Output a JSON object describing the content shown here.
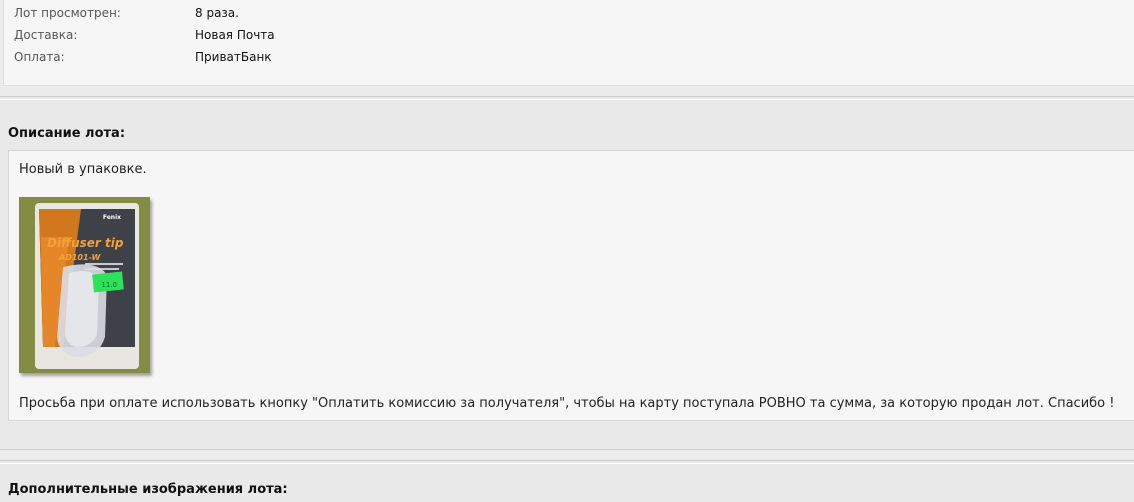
{
  "lot_info": {
    "rows": [
      {
        "label": "Лот просмотрен:",
        "value": "8 раза."
      },
      {
        "label": "Доставка:",
        "value": "Новая Почта"
      },
      {
        "label": "Оплата:",
        "value": "ПриватБанк"
      }
    ]
  },
  "description": {
    "title": "Описание лота:",
    "intro": "Новый в упаковке.",
    "image": {
      "brand": "Fenix",
      "product_name": "Diffuser tip",
      "model": "AD101-W",
      "price_tag": "11.0"
    },
    "note": "Просьба при оплате использовать кнопку \"Оплатить комиссию за получателя\", чтобы на карту поступала РОВНО та сумма, за которую продан лот. Спасибо !"
  },
  "additional_images": {
    "title": "Дополнительные изображения лота:"
  }
}
